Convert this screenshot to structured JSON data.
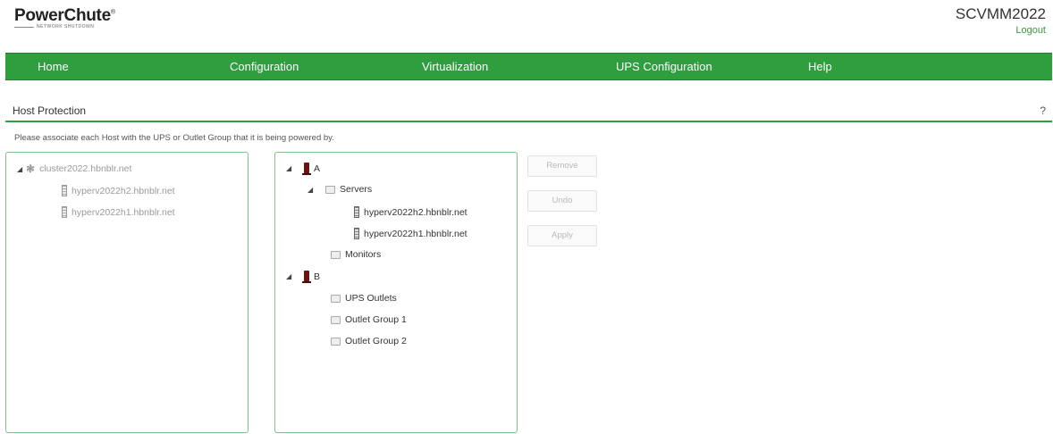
{
  "header": {
    "brand": "PowerChute",
    "brand_mark": "®",
    "brand_sub": "NETWORK SHUTDOWN",
    "hostname": "SCVMM2022",
    "logout": "Logout"
  },
  "nav": {
    "home": "Home",
    "configuration": "Configuration",
    "virtualization": "Virtualization",
    "ups_configuration": "UPS Configuration",
    "help": "Help"
  },
  "section": {
    "title": "Host Protection",
    "help": "?",
    "instructions": "Please associate each Host with the UPS or Outlet Group that it is being powered by."
  },
  "left_tree": {
    "cluster": "cluster2022.hbnblr.net",
    "hosts": [
      "hyperv2022h2.hbnblr.net",
      "hyperv2022h1.hbnblr.net"
    ]
  },
  "right_tree": {
    "ups_a": "A",
    "servers": "Servers",
    "server_hosts": [
      "hyperv2022h2.hbnblr.net",
      "hyperv2022h1.hbnblr.net"
    ],
    "monitors": "Monitors",
    "ups_b": "B",
    "ups_outlets": "UPS Outlets",
    "outlet_group_1": "Outlet Group 1",
    "outlet_group_2": "Outlet Group 2"
  },
  "buttons": {
    "remove": "Remove",
    "undo": "Undo",
    "apply": "Apply"
  },
  "colors": {
    "accent": "#2e9e3e",
    "ups": "#6b1212"
  },
  "icons": {
    "collapse": "triangle-down-left",
    "cluster": "cluster-icon",
    "host": "server-icon",
    "ups": "ups-icon",
    "group": "group-icon"
  }
}
